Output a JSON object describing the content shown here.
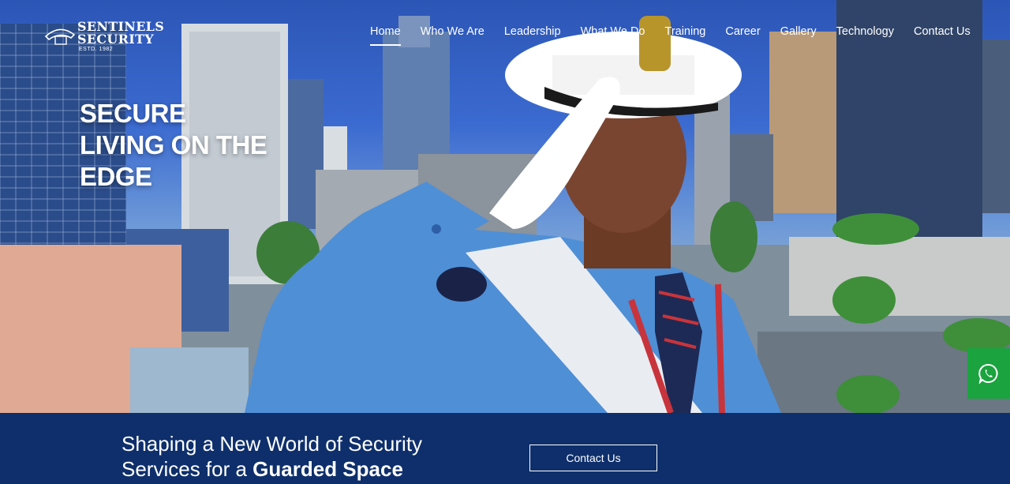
{
  "brand": {
    "line1": "SENTINELS",
    "line2": "SECURITY",
    "estd": "ESTD. 1982",
    "badge_text": "SENTINELS"
  },
  "nav": [
    {
      "label": "Home",
      "active": true
    },
    {
      "label": "Who We Are"
    },
    {
      "label": "Leadership"
    },
    {
      "label": "What We Do"
    },
    {
      "label": "Training"
    },
    {
      "label": "Career"
    },
    {
      "label": "Gallery"
    },
    {
      "label": "Technology"
    },
    {
      "label": "Contact Us"
    }
  ],
  "hero": {
    "line1": "SECURE",
    "line2": "LIVING ON THE",
    "line3": "EDGE"
  },
  "tagline": {
    "line1": "Shaping a New World of Security",
    "line2_plain": "Services for a ",
    "line2_bold": "Guarded Space"
  },
  "cta_label": "Contact Us",
  "colors": {
    "band": "#0e2f6b",
    "whatsapp": "#1aa33f",
    "shirt": "#4f8fd6"
  },
  "icons": {
    "whatsapp": "whatsapp-icon"
  }
}
